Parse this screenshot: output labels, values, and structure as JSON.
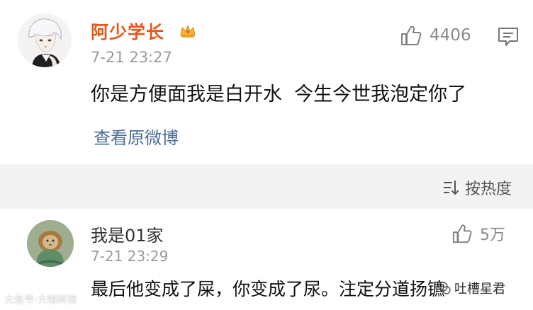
{
  "comments": [
    {
      "username": "阿少学长",
      "timestamp": "7-21 23:27",
      "like_count": "4406",
      "text": "你是方便面我是白开水  今生今世我泡定你了",
      "view_original_label": "查看原微博",
      "has_crown_badge": true
    },
    {
      "username": "我是01家",
      "timestamp": "7-21 23:29",
      "like_count": "5万",
      "text": "最后他变成了屎，你变成了尿。注定分道扬镳"
    }
  ],
  "sort": {
    "label": "按热度"
  },
  "watermarks": {
    "left": "大鱼号·大咖跨境",
    "right": "吐槽星君"
  },
  "colors": {
    "username_vip": "#e25a1c",
    "link": "#4a6d95",
    "meta_gray": "#9a9a9a",
    "sort_bar_bg": "#f3f3f3"
  },
  "icons": {
    "like": "thumbs-up-icon",
    "comment": "comment-icon",
    "sort": "sort-icon",
    "crown": "crown-icon"
  }
}
